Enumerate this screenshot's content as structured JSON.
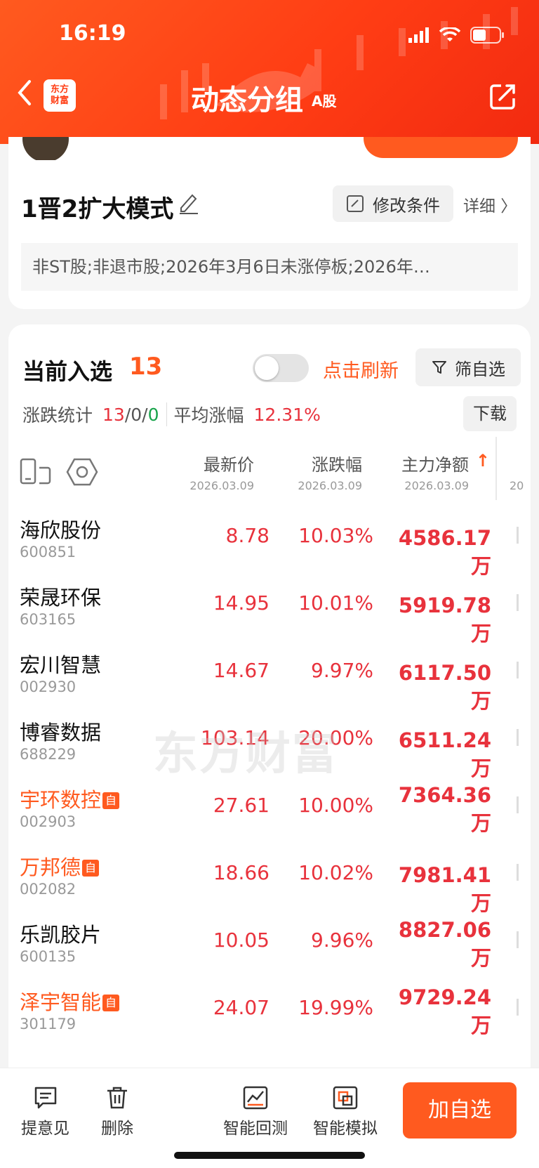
{
  "status": {
    "time": "16:19"
  },
  "header": {
    "logo": "东方\n财富",
    "logo_line1": "东方",
    "logo_line2": "财富",
    "title": "动态分组",
    "title_tag": "A股",
    "back_icon": "chevron-left-icon",
    "share_icon": "share-icon"
  },
  "strategy": {
    "name": "1晋2扩大模式",
    "modify_label": "修改条件",
    "detail_label": "详细 〉",
    "conditions": "非ST股;非退市股;2026年3月6日未涨停板;2026年…"
  },
  "selection": {
    "label": "当前入选",
    "count": "13",
    "refresh_label": "点击刷新",
    "filter_label": "筛自选",
    "stats_label": "涨跌统计",
    "stats_up": "13",
    "stats_sep1": "/",
    "stats_flat": "0",
    "stats_sep2": "/",
    "stats_down": "0",
    "avg_label": "平均涨幅",
    "avg_value": "12.31%",
    "download_label": "下载"
  },
  "columns": [
    {
      "label": "最新价",
      "date": "2026.03.09"
    },
    {
      "label": "涨跌幅",
      "date": "2026.03.09"
    },
    {
      "label": "主力净额",
      "date": "2026.03.09",
      "sort": "↑"
    },
    {
      "label": "",
      "date": "20"
    }
  ],
  "rows": [
    {
      "name": "海欣股份",
      "code": "600851",
      "price": "8.78",
      "change": "10.03%",
      "flow": "4586.17万",
      "mine": false
    },
    {
      "name": "荣晟环保",
      "code": "603165",
      "price": "14.95",
      "change": "10.01%",
      "flow": "5919.78万",
      "mine": false
    },
    {
      "name": "宏川智慧",
      "code": "002930",
      "price": "14.67",
      "change": "9.97%",
      "flow": "6117.50万",
      "mine": false
    },
    {
      "name": "博睿数据",
      "code": "688229",
      "price": "103.14",
      "change": "20.00%",
      "flow": "6511.24万",
      "mine": false
    },
    {
      "name": "宇环数控",
      "code": "002903",
      "price": "27.61",
      "change": "10.00%",
      "flow": "7364.36万",
      "mine": true
    },
    {
      "name": "万邦德",
      "code": "002082",
      "price": "18.66",
      "change": "10.02%",
      "flow": "7981.41万",
      "mine": true
    },
    {
      "name": "乐凯胶片",
      "code": "600135",
      "price": "10.05",
      "change": "9.96%",
      "flow": "8827.06万",
      "mine": false
    },
    {
      "name": "泽宇智能",
      "code": "301179",
      "price": "24.07",
      "change": "19.99%",
      "flow": "9729.24万",
      "mine": true
    }
  ],
  "badge_label": "自",
  "watermark": "东方财富",
  "bottom_bar": {
    "feedback": "提意见",
    "delete": "删除",
    "backtest": "智能回测",
    "simulate": "智能模拟",
    "add_watchlist": "加自选"
  }
}
